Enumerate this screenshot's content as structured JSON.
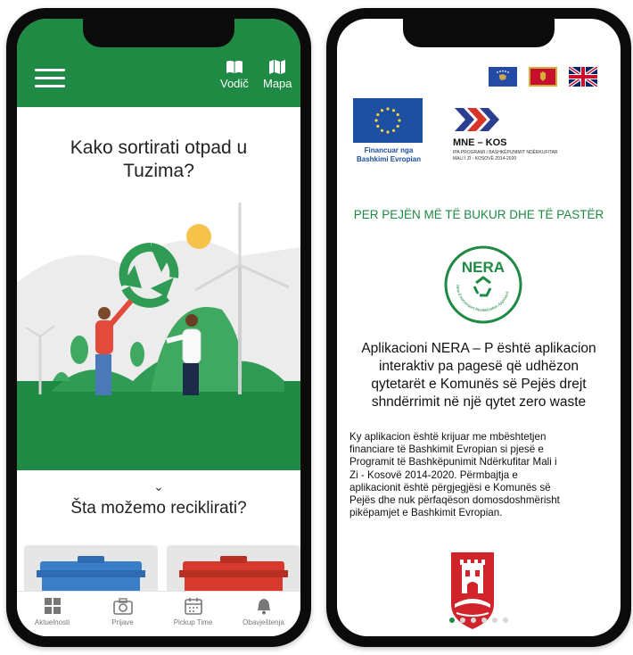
{
  "left_screen": {
    "header": {
      "guide_label": "Vodič",
      "map_label": "Mapa"
    },
    "title_line1": "Kako sortirati otpad u",
    "title_line2": "Tuzima?",
    "section_title": "Šta možemo reciklirati?",
    "scroll_hint": "⌄",
    "tabs": [
      {
        "label": "Aktuelnosti",
        "icon": "grid-icon"
      },
      {
        "label": "Prijave",
        "icon": "camera-icon"
      },
      {
        "label": "Pickup Time",
        "icon": "calendar-icon"
      },
      {
        "label": "Obavještenja",
        "icon": "bell-icon"
      }
    ],
    "colors": {
      "brand_green": "#1e8a43",
      "bin_blue": "#3a7ec7",
      "bin_red": "#d63a2c"
    }
  },
  "right_screen": {
    "eu_caption_line1": "Financuar nga",
    "eu_caption_line2": "Bashkimi Evropian",
    "program_title": "MNE – KOS",
    "program_sub_line1": "IPA PROGRAMI I BASHKËPUNIMIT NDËRKUFITAR",
    "program_sub_line2": "MALI I ZI - KOSOVË 2014-2020",
    "slogan": "PER PEJËN MË TË BUKUR DHE TË PASTËR",
    "nera_logo_text": "NERA",
    "nera_ring_text": "New Environment Revitalization Approach",
    "title_lines": [
      "Aplikacioni NERA – P është aplikacion",
      "interaktiv pa pagesë që udhëzon",
      "qytetarët e Komunës së Pejës drejt",
      "shndërrimit në një qytet zero waste"
    ],
    "body_lines": [
      "Ky aplikacion është krijuar me mbështetjen",
      "financiare të Bashkimit Evropian si pjesë e",
      "Programit të Bashkëpunimit Ndërkufitar Mali i",
      "Zi - Kosovë 2014-2020. Përmbajtja e",
      "aplikacionit është përgjegjësi e Komunës së",
      "Pejës dhe nuk përfaqëson domosdoshmërisht",
      "pikëpamjet e Bashkimit Evropian."
    ],
    "pager": {
      "count": 6,
      "active": 1
    },
    "flags": [
      "kosovo-flag",
      "montenegro-flag",
      "uk-flag"
    ]
  }
}
